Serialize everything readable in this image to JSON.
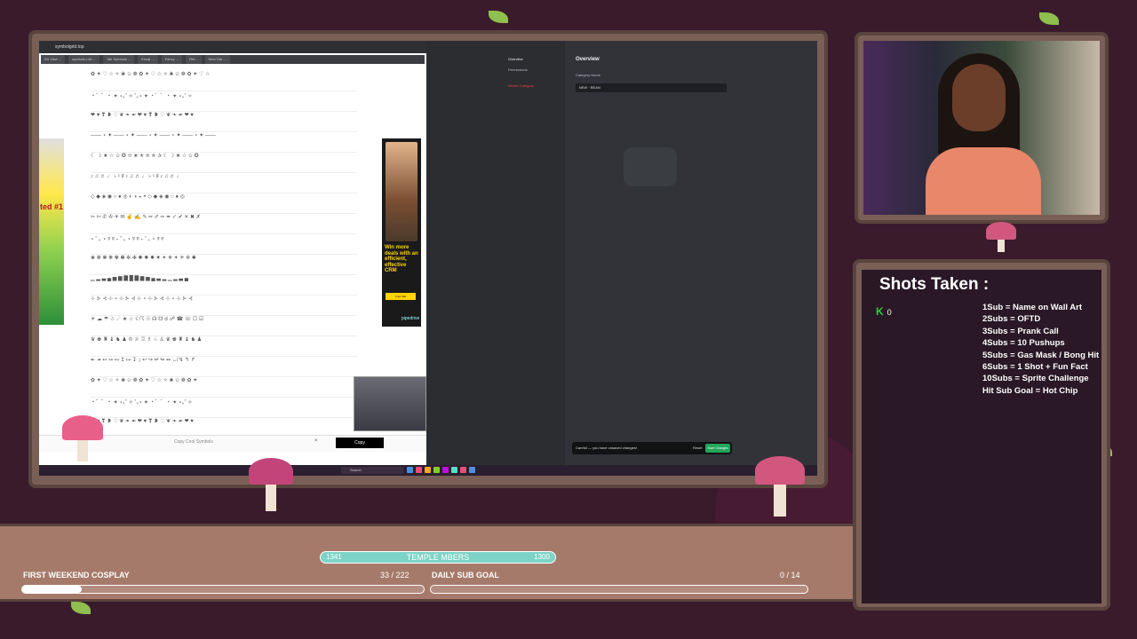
{
  "browser": {
    "url": "symbolgrid.top",
    "tabs": [
      "Dir View ...",
      "symbols-List ...",
      "Tab Symbols ...",
      "Emoji ...",
      "Fancy ...",
      "Ref...",
      "New Tab ..."
    ],
    "ad_left_text": "ted #1",
    "ad_right": {
      "headline": "Win more deals with an efficient, effective CRM",
      "button": "Free trial",
      "brand": "pipedrive"
    },
    "copy_bar": {
      "label": "Copy Cool Symbols",
      "close": "×",
      "copy_button": "Copy"
    },
    "taskbar_search": "Search"
  },
  "discord": {
    "sidebar": {
      "overview": "Overview",
      "permissions": "Permissions",
      "delete": "Delete Category"
    },
    "main": {
      "title": "Overview",
      "category_name_label": "Category Name",
      "category_name_value": "NEW · BEAN",
      "unsaved_text": "Careful — you have unsaved changes!",
      "reset": "Reset",
      "save": "Save Changes"
    }
  },
  "shots": {
    "title": "Shots Taken :",
    "counter": "0",
    "goals": [
      "1Sub = Name on Wall Art",
      "2Subs = OFTD",
      "3Subs = Prank Call",
      "4Subs = 10 Pushups",
      "5Subs = Gas Mask / Bong Hit",
      "6Subs = 1 Shot + Fun Fact",
      "10Subs =  Sprite Challenge",
      "Hit Sub Goal  = Hot Chip"
    ]
  },
  "banner": {
    "member_left": "1341",
    "member_label": "TEMPLE MBERS",
    "member_right": "1300",
    "cosplay_label": "FIRST WEEKEND COSPLAY",
    "cosplay_count": "33  /  222",
    "cosplay_progress": 0.149,
    "subgoal_label": "DAILY SUB GOAL",
    "subgoal_count": "0  /  14",
    "subgoal_progress": 0
  },
  "colors": {
    "accent": "#7dd3c7",
    "panel": "#2a1826",
    "frame": "#7a5f57",
    "save": "#23a55a",
    "danger": "#f23f43"
  }
}
